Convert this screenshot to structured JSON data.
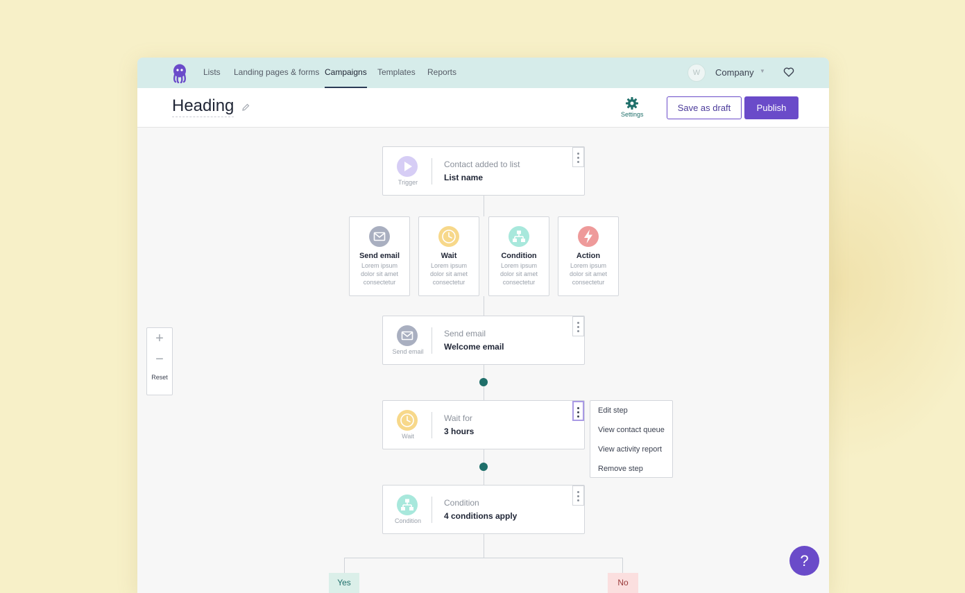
{
  "nav": {
    "items": [
      {
        "label": "Lists"
      },
      {
        "label": "Landing pages & forms"
      },
      {
        "label": "Campaigns"
      },
      {
        "label": "Templates"
      },
      {
        "label": "Reports"
      }
    ],
    "active": "Campaigns",
    "company_initial": "W",
    "company_name": "Company"
  },
  "header": {
    "title": "Heading",
    "settings_label": "Settings",
    "save_draft_label": "Save as draft",
    "publish_label": "Publish"
  },
  "trigger_node": {
    "icon_label": "Trigger",
    "label": "Contact added to list",
    "value": "List name"
  },
  "step_options": [
    {
      "title": "Send email",
      "description": "Lorem ipsum dolor sit amet consectetur",
      "icon": "envelope-icon",
      "color": "#a9afc0"
    },
    {
      "title": "Wait",
      "description": "Lorem ipsum dolor sit amet consectetur",
      "icon": "clock-icon",
      "color": "#f7d88a"
    },
    {
      "title": "Condition",
      "description": "Lorem ipsum dolor sit amet consectetur",
      "icon": "condition-icon",
      "color": "#a8e8dc"
    },
    {
      "title": "Action",
      "description": "Lorem ipsum dolor sit amet consectetur",
      "icon": "bolt-icon",
      "color": "#ee9a9a"
    }
  ],
  "email_node": {
    "icon_label": "Send email",
    "label": "Send email",
    "value": "Welcome email"
  },
  "wait_node": {
    "icon_label": "Wait",
    "label": "Wait for",
    "value": "3 hours"
  },
  "condition_node": {
    "icon_label": "Condition",
    "label": "Condition",
    "value": "4 conditions apply"
  },
  "context_menu": {
    "items": [
      "Edit step",
      "View contact queue",
      "View activity report",
      "Remove step"
    ]
  },
  "zoom": {
    "plus": "+",
    "minus": "−",
    "reset": "Reset"
  },
  "branches": {
    "yes": "Yes",
    "no": "No"
  },
  "help": {
    "label": "?"
  },
  "colors": {
    "accent": "#6a4bc9",
    "teal": "#1f6f6a",
    "nav_bg": "#d6ecea",
    "page_bg": "#f7f0c8"
  }
}
